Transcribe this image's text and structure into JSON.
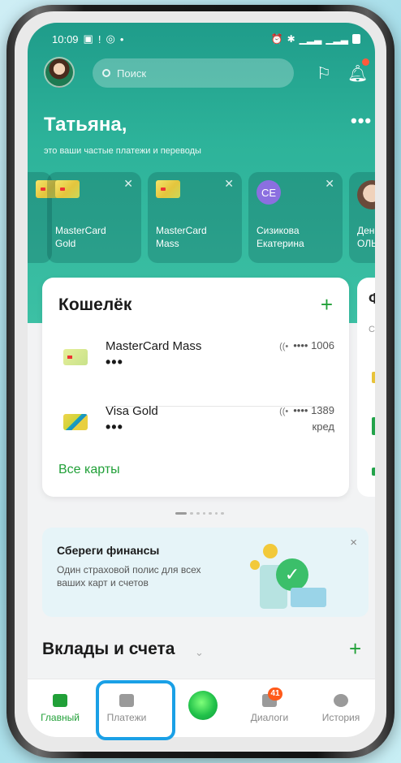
{
  "status": {
    "time": "10:09"
  },
  "header": {
    "search_placeholder": "Поиск",
    "greeting": "Татьяна,",
    "subtitle": "это ваши частые платежи и переводы",
    "more": "•••"
  },
  "quick": [
    {
      "title": "MasterCard\nGold",
      "type": "card"
    },
    {
      "title": "MasterCard\nMass",
      "type": "card"
    },
    {
      "title": "Сизикова\nЕкатерина",
      "type": "contact",
      "initials": "СЕ"
    },
    {
      "title": "Ден\nОЛЬ",
      "type": "photo"
    }
  ],
  "wallet": {
    "title": "Кошелёк",
    "add": "+",
    "cards": [
      {
        "name": "MasterCard Mass",
        "masked": "•••",
        "number": "•••• 1006",
        "nfc": "((•",
        "extra": ""
      },
      {
        "name": "Visa Gold",
        "masked": "•••",
        "number": "•••• 1389",
        "nfc": "((•",
        "extra": "кред"
      }
    ],
    "all_cards": "Все карты"
  },
  "peek": {
    "letter": "Ф",
    "sub": "С"
  },
  "promo": {
    "title": "Сбереги финансы",
    "text": "Один страховой полис для всех ваших карт и счетов",
    "close": "×"
  },
  "deposits": {
    "title": "Вклады и счета",
    "chevron": "⌄",
    "add": "+"
  },
  "nav": {
    "home": "Главный",
    "payments": "Платежи",
    "dialogs": "Диалоги",
    "history": "История",
    "badge": "41"
  },
  "colors": {
    "brand": "#21a038",
    "hero": "#2db39a",
    "highlight": "#1aa0e6",
    "badge": "#ff5a1a"
  }
}
